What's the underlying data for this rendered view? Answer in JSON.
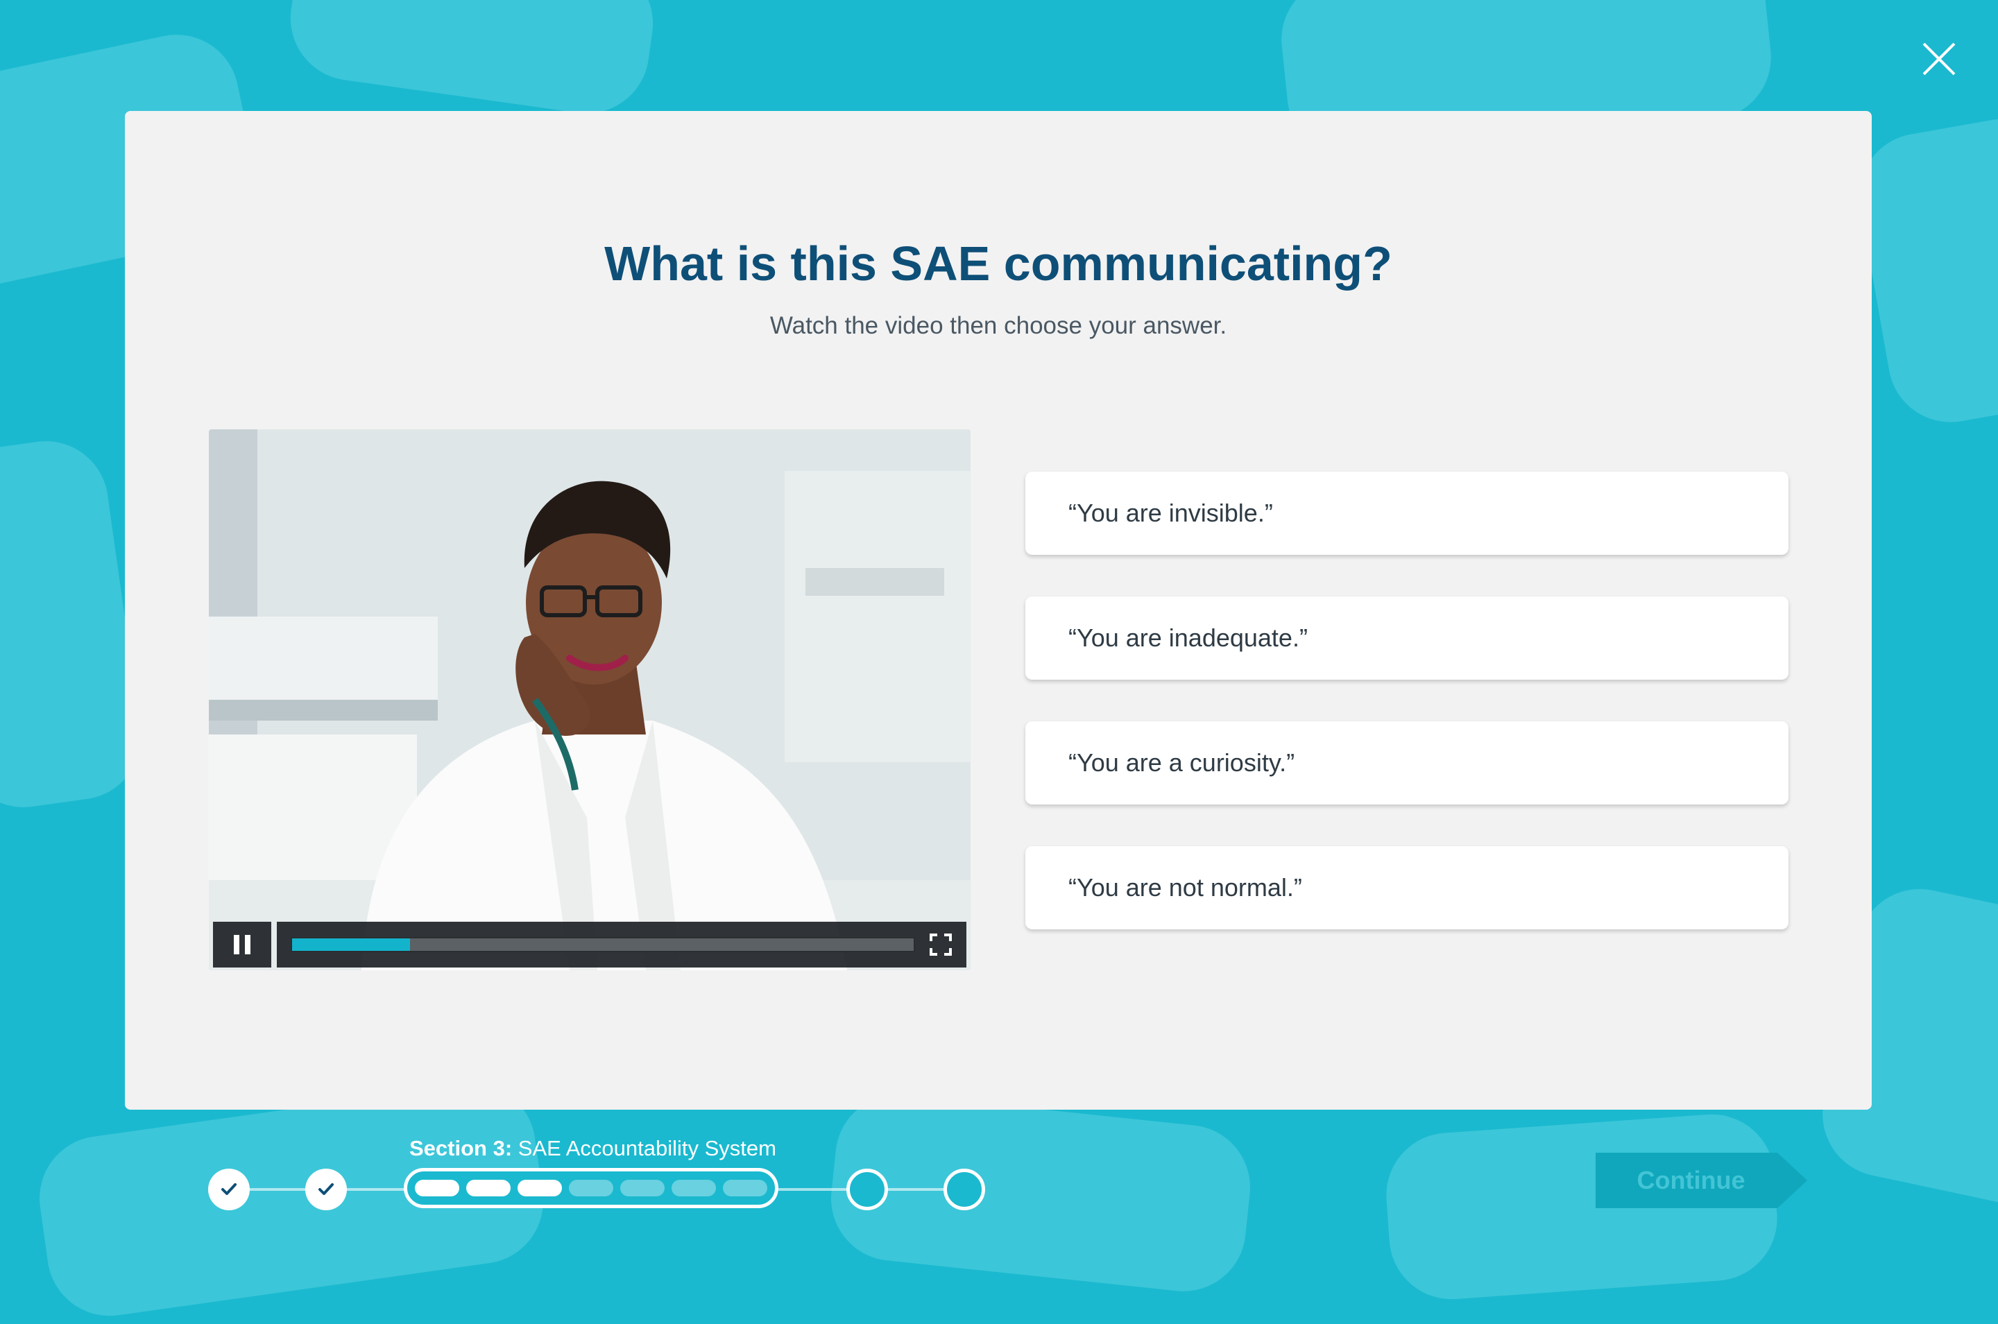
{
  "header": {
    "close_icon": "close-icon"
  },
  "question": {
    "title": "What is this SAE communicating?",
    "subtitle": "Watch the video then choose your answer."
  },
  "video": {
    "state": "playing",
    "progress": 0.19,
    "play_pause_icon": "pause-icon",
    "fullscreen_icon": "fullscreen-icon"
  },
  "answers": [
    {
      "label": "“You are invisible.”"
    },
    {
      "label": "“You are inadequate.”"
    },
    {
      "label": "“You are a curiosity.”"
    },
    {
      "label": "“You are not normal.”"
    }
  ],
  "progress": {
    "section_prefix": "Section 3:",
    "section_name": "SAE Accountability System",
    "completed_steps": 2,
    "total_steps": 5,
    "current_step": 3,
    "current_step_segments_total": 7,
    "current_step_segments_done": 3
  },
  "footer": {
    "continue_label": "Continue"
  },
  "colors": {
    "background": "#1ab9cf",
    "card": "#f2f2f2",
    "title": "#0e4f78",
    "accent": "#13b3cc",
    "continue_disabled": "#10a7bc"
  }
}
